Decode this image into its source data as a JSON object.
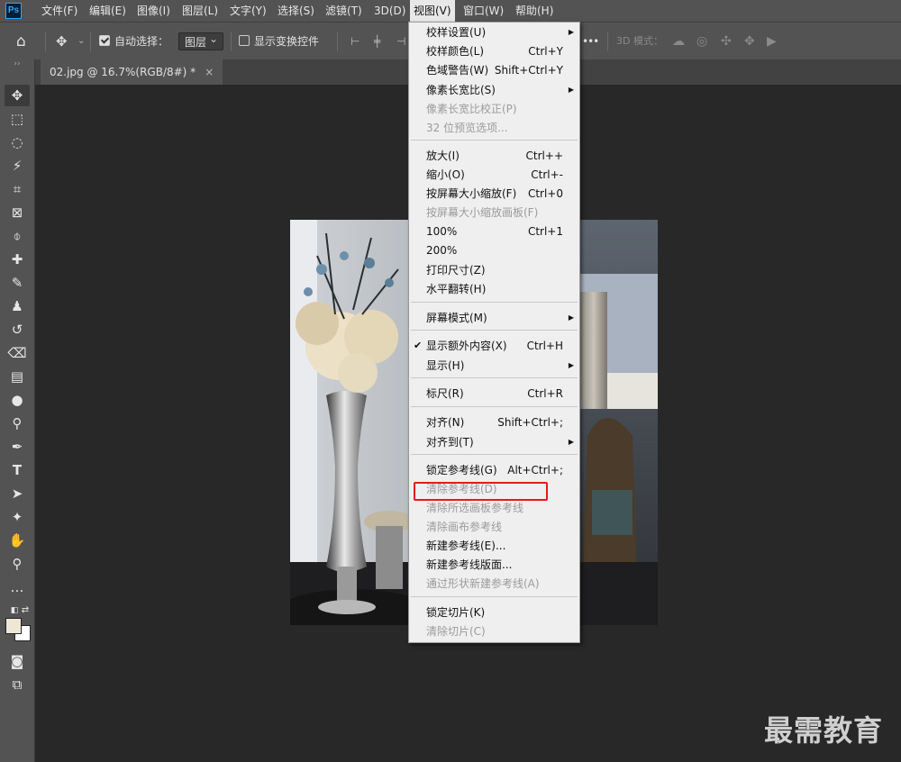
{
  "app": {
    "logo": "Ps"
  },
  "menubar": [
    "文件(F)",
    "编辑(E)",
    "图像(I)",
    "图层(L)",
    "文字(Y)",
    "选择(S)",
    "滤镜(T)",
    "3D(D)",
    "视图(V)",
    "窗口(W)",
    "帮助(H)"
  ],
  "options": {
    "auto_select_label": "自动选择：",
    "auto_select_value": "图层",
    "show_transform_label": "显示变换控件",
    "mode3d_label": "3D 模式：",
    "more": "•••"
  },
  "document": {
    "tab_title": "02.jpg @ 16.7%(RGB/8#) *",
    "close": "×"
  },
  "view_menu": {
    "items": [
      {
        "label": "校样设置(U)",
        "shortcut": "",
        "submenu": true,
        "disabled": false,
        "checked": false
      },
      {
        "label": "校样颜色(L)",
        "shortcut": "Ctrl+Y",
        "submenu": false,
        "disabled": false,
        "checked": false
      },
      {
        "label": "色域警告(W)",
        "shortcut": "Shift+Ctrl+Y",
        "submenu": false,
        "disabled": false,
        "checked": false
      },
      {
        "label": "像素长宽比(S)",
        "shortcut": "",
        "submenu": true,
        "disabled": false,
        "checked": false
      },
      {
        "label": "像素长宽比校正(P)",
        "shortcut": "",
        "submenu": false,
        "disabled": true,
        "checked": false
      },
      {
        "label": "32 位预览选项...",
        "shortcut": "",
        "submenu": false,
        "disabled": true,
        "checked": false
      },
      {
        "label": "放大(I)",
        "shortcut": "Ctrl++",
        "submenu": false,
        "disabled": false,
        "checked": false
      },
      {
        "label": "缩小(O)",
        "shortcut": "Ctrl+-",
        "submenu": false,
        "disabled": false,
        "checked": false
      },
      {
        "label": "按屏幕大小缩放(F)",
        "shortcut": "Ctrl+0",
        "submenu": false,
        "disabled": false,
        "checked": false
      },
      {
        "label": "按屏幕大小缩放画板(F)",
        "shortcut": "",
        "submenu": false,
        "disabled": true,
        "checked": false
      },
      {
        "label": "100%",
        "shortcut": "Ctrl+1",
        "submenu": false,
        "disabled": false,
        "checked": false
      },
      {
        "label": "200%",
        "shortcut": "",
        "submenu": false,
        "disabled": false,
        "checked": false
      },
      {
        "label": "打印尺寸(Z)",
        "shortcut": "",
        "submenu": false,
        "disabled": false,
        "checked": false
      },
      {
        "label": "水平翻转(H)",
        "shortcut": "",
        "submenu": false,
        "disabled": false,
        "checked": false
      },
      {
        "label": "屏幕模式(M)",
        "shortcut": "",
        "submenu": true,
        "disabled": false,
        "checked": false
      },
      {
        "label": "显示额外内容(X)",
        "shortcut": "Ctrl+H",
        "submenu": false,
        "disabled": false,
        "checked": true
      },
      {
        "label": "显示(H)",
        "shortcut": "",
        "submenu": true,
        "disabled": false,
        "checked": false
      },
      {
        "label": "标尺(R)",
        "shortcut": "Ctrl+R",
        "submenu": false,
        "disabled": false,
        "checked": false
      },
      {
        "label": "对齐(N)",
        "shortcut": "Shift+Ctrl+;",
        "submenu": false,
        "disabled": false,
        "checked": false
      },
      {
        "label": "对齐到(T)",
        "shortcut": "",
        "submenu": true,
        "disabled": false,
        "checked": false
      },
      {
        "label": "锁定参考线(G)",
        "shortcut": "Alt+Ctrl+;",
        "submenu": false,
        "disabled": false,
        "checked": false
      },
      {
        "label": "清除参考线(D)",
        "shortcut": "",
        "submenu": false,
        "disabled": true,
        "checked": false
      },
      {
        "label": "清除所选画板参考线",
        "shortcut": "",
        "submenu": false,
        "disabled": true,
        "checked": false
      },
      {
        "label": "清除画布参考线",
        "shortcut": "",
        "submenu": false,
        "disabled": true,
        "checked": false
      },
      {
        "label": "新建参考线(E)...",
        "shortcut": "",
        "submenu": false,
        "disabled": false,
        "checked": false
      },
      {
        "label": "新建参考线版面...",
        "shortcut": "",
        "submenu": false,
        "disabled": false,
        "checked": false
      },
      {
        "label": "通过形状新建参考线(A)",
        "shortcut": "",
        "submenu": false,
        "disabled": true,
        "checked": false
      },
      {
        "label": "锁定切片(K)",
        "shortcut": "",
        "submenu": false,
        "disabled": false,
        "checked": false
      },
      {
        "label": "清除切片(C)",
        "shortcut": "",
        "submenu": false,
        "disabled": true,
        "checked": false
      }
    ]
  },
  "watermark": "最需教育",
  "colors": {
    "accent_highlight": "#e31b1b",
    "foreground_swatch": "#efe7d6",
    "background_swatch": "#ffffff"
  }
}
